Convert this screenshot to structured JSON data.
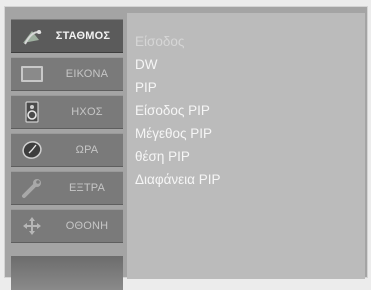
{
  "sidebar": {
    "items": [
      {
        "label": "ΣΤΑΘΜΟΣ",
        "icon": "satellite-dish-icon",
        "selected": true
      },
      {
        "label": "ΕΙΚΟΝΑ",
        "icon": "tv-screen-icon",
        "selected": false
      },
      {
        "label": "ΗΧΟΣ",
        "icon": "speaker-icon",
        "selected": false
      },
      {
        "label": "ΩΡΑ",
        "icon": "clock-icon",
        "selected": false
      },
      {
        "label": "ΕΞΤΡΑ",
        "icon": "wrench-icon",
        "selected": false
      },
      {
        "label": "ΟΘΟΝΗ",
        "icon": "move-arrows-icon",
        "selected": false
      }
    ]
  },
  "submenu": {
    "items": [
      {
        "label": "Είσοδος"
      },
      {
        "label": "DW"
      },
      {
        "label": "PIP"
      },
      {
        "label": "Είσοδος PIP"
      },
      {
        "label": "Μέγεθος PIP"
      },
      {
        "label": "θέση PIP"
      },
      {
        "label": "Διαφάνεια PIP"
      }
    ]
  }
}
